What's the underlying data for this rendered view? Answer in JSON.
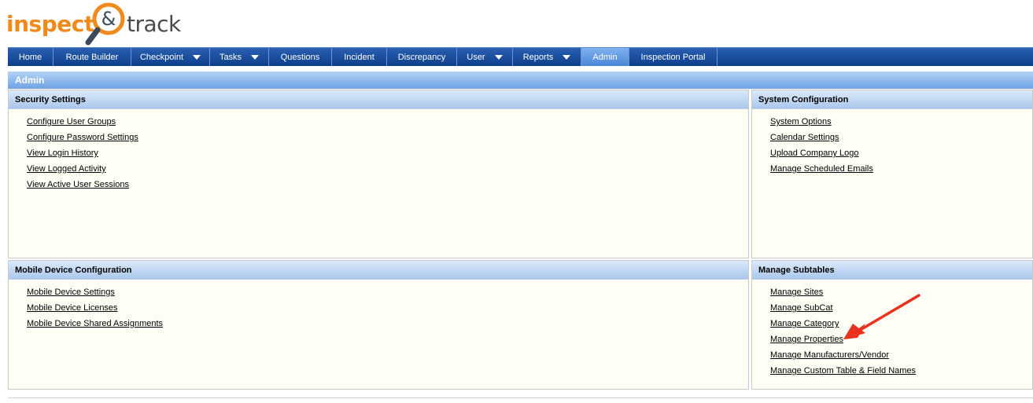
{
  "logo": {
    "word1": "inspect",
    "amp": "&",
    "word2": "track"
  },
  "nav": [
    {
      "label": "Home",
      "caret": false,
      "active": false,
      "width": 58
    },
    {
      "label": "Route Builder",
      "caret": false,
      "active": false,
      "width": 99
    },
    {
      "label": "Checkpoint",
      "caret": true,
      "active": false,
      "width": 100
    },
    {
      "label": "Tasks",
      "caret": true,
      "active": false,
      "width": 75
    },
    {
      "label": "Questions",
      "caret": false,
      "active": false,
      "width": 80
    },
    {
      "label": "Incident",
      "caret": false,
      "active": false,
      "width": 70
    },
    {
      "label": "Discrepancy",
      "caret": false,
      "active": false,
      "width": 89
    },
    {
      "label": "User",
      "caret": true,
      "active": false,
      "width": 71
    },
    {
      "label": "Reports",
      "caret": true,
      "active": false,
      "width": 87
    },
    {
      "label": "Admin",
      "caret": false,
      "active": true,
      "width": 61
    },
    {
      "label": "Inspection Portal",
      "caret": false,
      "active": false,
      "width": 112
    }
  ],
  "page_title": "Admin",
  "panels": {
    "security": {
      "title": "Security Settings",
      "links": [
        "Configure User Groups",
        "Configure Password Settings",
        "View Login History",
        "View Logged Activity",
        "View Active User Sessions"
      ]
    },
    "system": {
      "title": "System Configuration",
      "links": [
        "System Options",
        "Calendar Settings",
        "Upload Company Logo",
        "Manage Scheduled Emails"
      ]
    },
    "mobile": {
      "title": "Mobile Device Configuration",
      "links": [
        "Mobile Device Settings",
        "Mobile Device Licenses",
        "Mobile Device Shared Assignments"
      ]
    },
    "subtables": {
      "title": "Manage Subtables",
      "links": [
        "Manage Sites",
        "Manage SubCat",
        "Manage Category",
        "Manage Properties",
        "Manage Manufacturers/Vendor",
        "Manage Custom Table & Field Names"
      ]
    }
  },
  "colors": {
    "brand_orange": "#f08a1c",
    "nav_blue": "#0d3f8a",
    "annotation_red": "#e8321e"
  }
}
